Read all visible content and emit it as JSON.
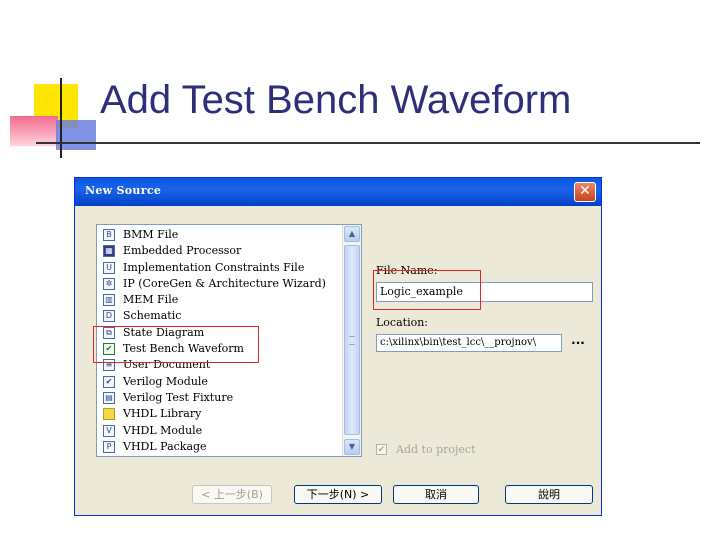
{
  "slide": {
    "title": "Add Test Bench Waveform"
  },
  "dialog": {
    "title": "New Source",
    "close_glyph": "✕",
    "source_types": [
      {
        "label": "BMM File",
        "icon": "bmm-file-icon",
        "glyph": "B"
      },
      {
        "label": "Embedded Processor",
        "icon": "embedded-processor-icon",
        "glyph": "▦"
      },
      {
        "label": "Implementation Constraints File",
        "icon": "ucf-file-icon",
        "glyph": "U"
      },
      {
        "label": "IP (CoreGen & Architecture Wizard)",
        "icon": "ip-core-icon",
        "glyph": "✲"
      },
      {
        "label": "MEM File",
        "icon": "mem-file-icon",
        "glyph": "▥"
      },
      {
        "label": "Schematic",
        "icon": "schematic-icon",
        "glyph": "D"
      },
      {
        "label": "State Diagram",
        "icon": "state-diagram-icon",
        "glyph": "⧉"
      },
      {
        "label": "Test Bench Waveform",
        "icon": "waveform-icon",
        "glyph": "✔"
      },
      {
        "label": "User Document",
        "icon": "document-icon",
        "glyph": "≡"
      },
      {
        "label": "Verilog Module",
        "icon": "verilog-module-icon",
        "glyph": "✔"
      },
      {
        "label": "Verilog Test Fixture",
        "icon": "test-fixture-icon",
        "glyph": "▤"
      },
      {
        "label": "VHDL Library",
        "icon": "folder-icon",
        "glyph": ""
      },
      {
        "label": "VHDL Module",
        "icon": "vhdl-module-icon",
        "glyph": "V"
      },
      {
        "label": "VHDL Package",
        "icon": "vhdl-package-icon",
        "glyph": "P"
      }
    ],
    "file_name_label": "File Name:",
    "file_name_value": "Logic_example",
    "location_label": "Location:",
    "location_value": "c:\\xilinx\\bin\\test_lcc\\__projnov\\",
    "browse_label": "...",
    "add_to_project_label": "Add to project",
    "buttons": {
      "back": "< 上一步(B)",
      "next": "下一步(N) >",
      "cancel": "取消",
      "help": "說明"
    }
  }
}
